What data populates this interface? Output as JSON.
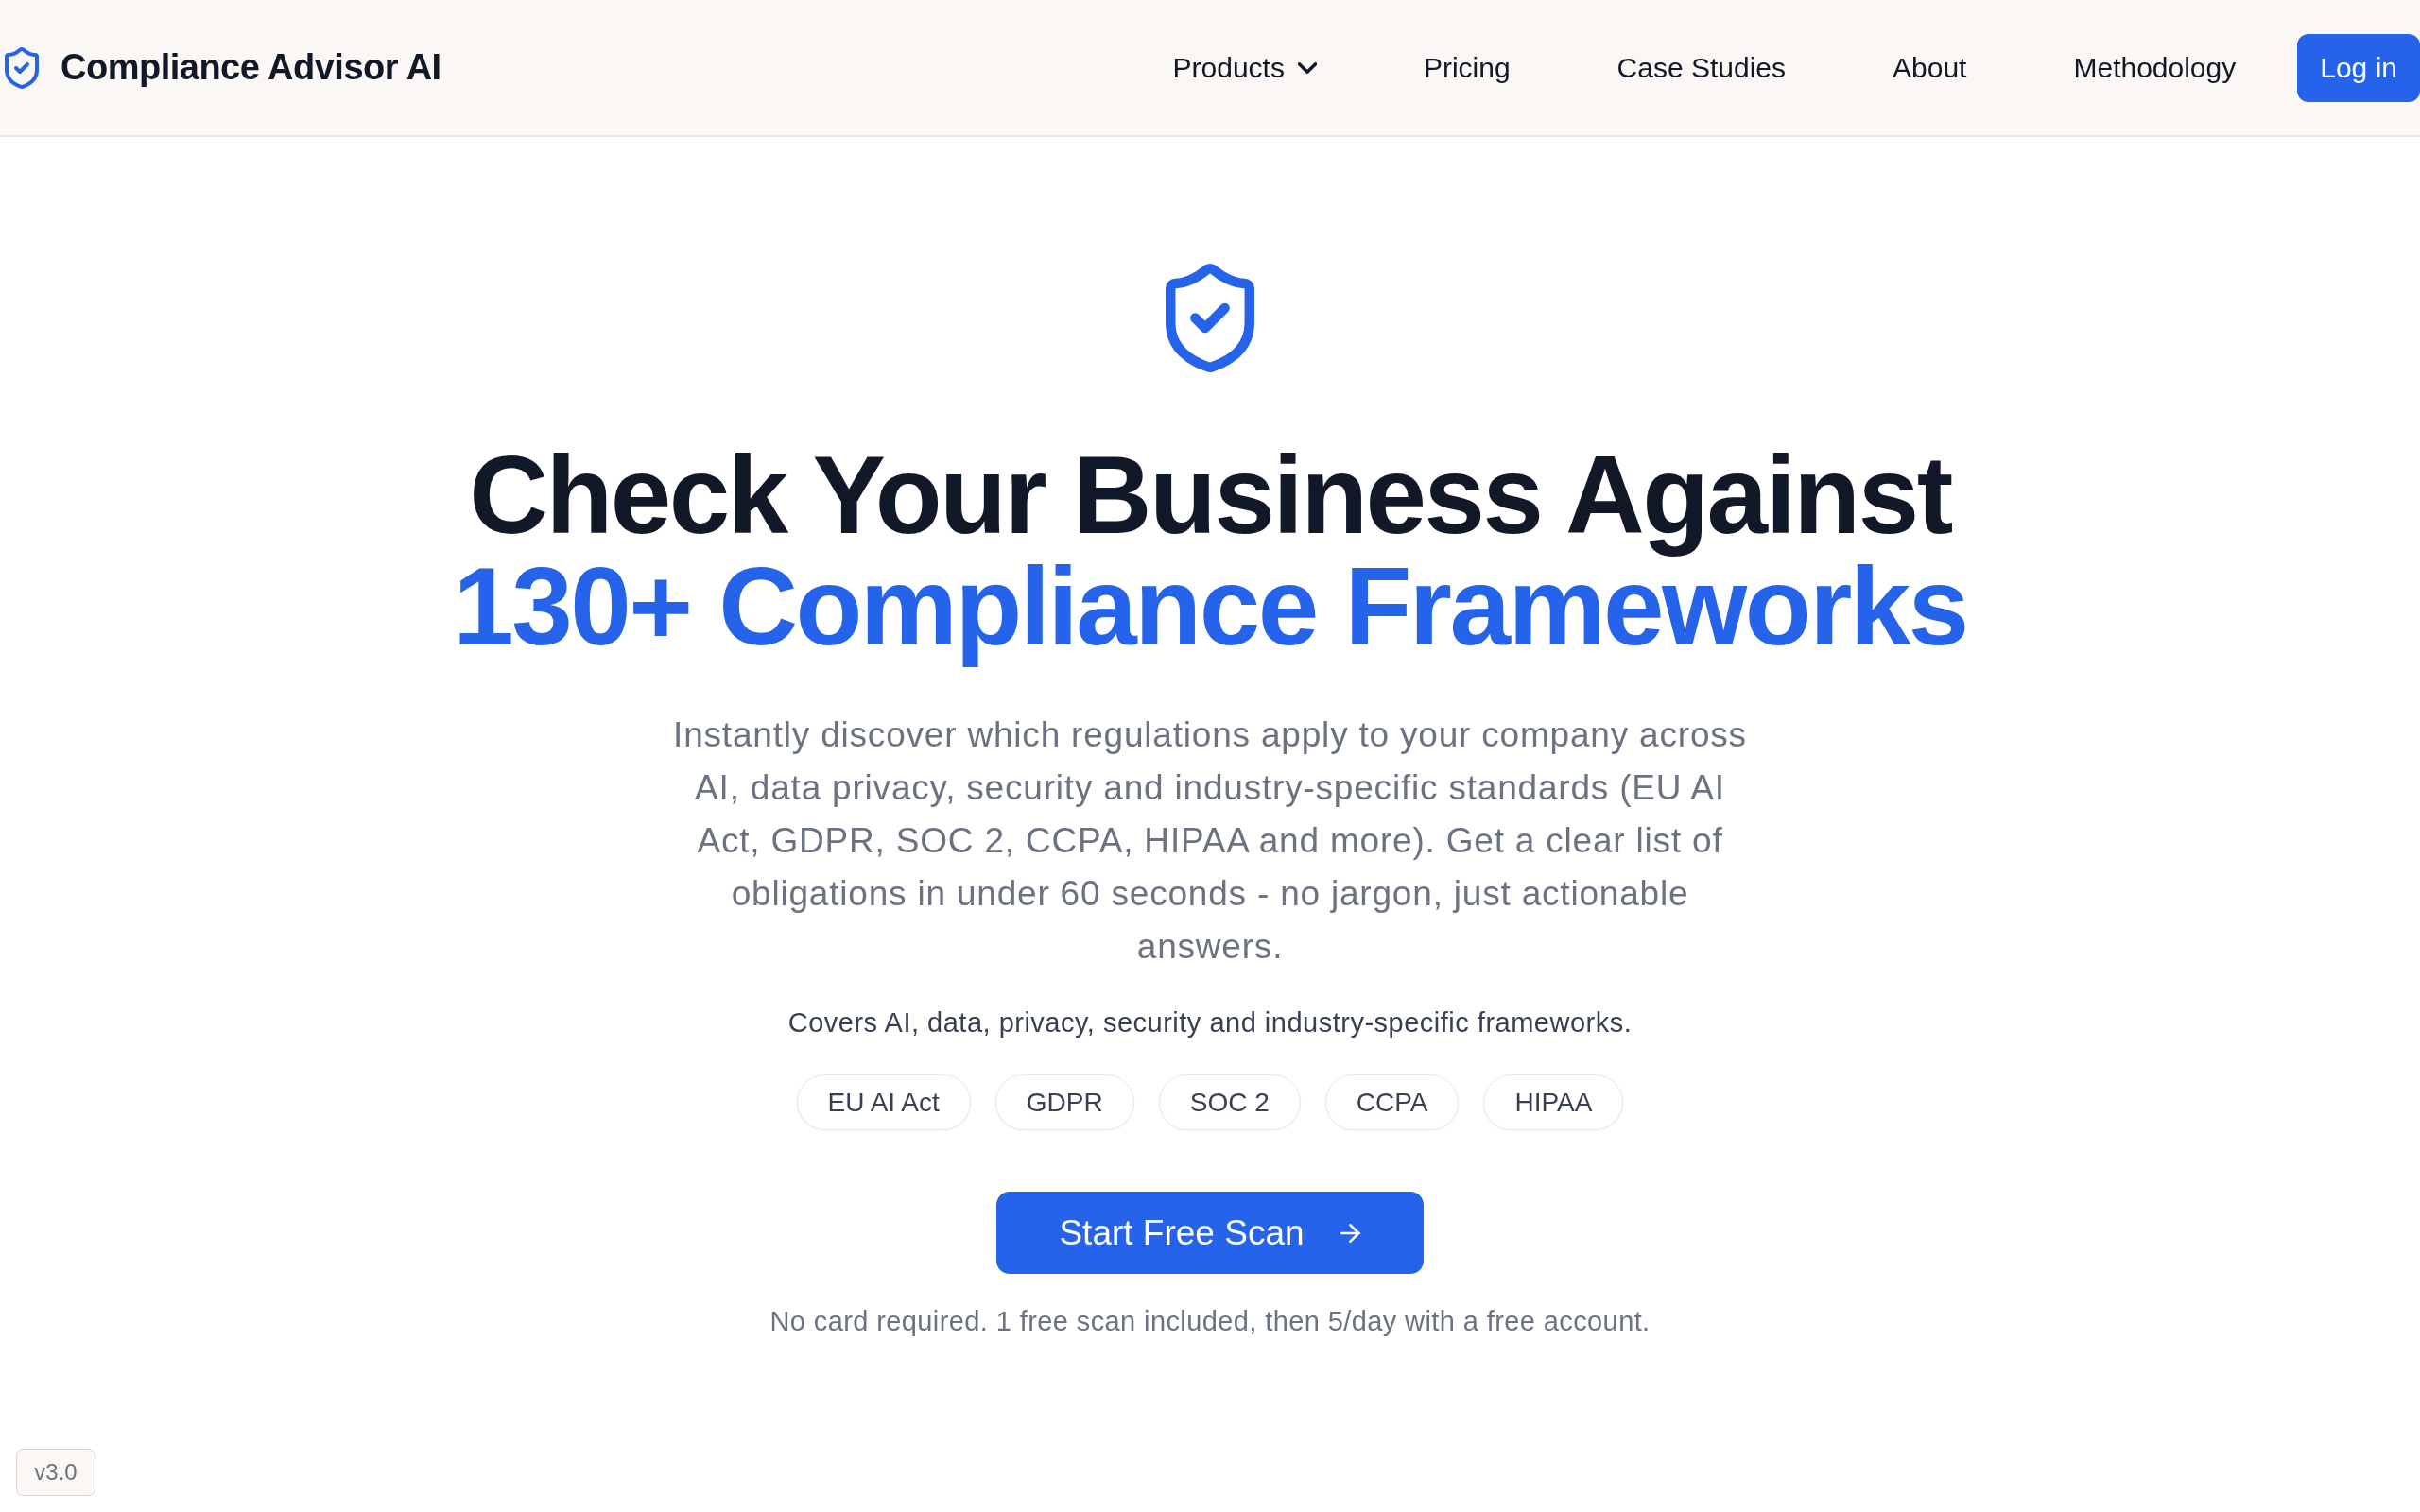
{
  "navbar": {
    "brand": "Compliance Advisor AI",
    "items": [
      {
        "label": "Products",
        "kind": "dropdown"
      },
      {
        "label": "Pricing",
        "kind": "link"
      },
      {
        "label": "Case Studies",
        "kind": "link"
      },
      {
        "label": "About",
        "kind": "link"
      },
      {
        "label": "Methodology",
        "kind": "link"
      }
    ],
    "login_button": "Log in"
  },
  "hero": {
    "title": "Check Your Business Against",
    "title_highlight": "130+ Compliance Frameworks",
    "description": "Instantly discover which regulations apply to your company across AI, data privacy, security and industry-specific standards (EU AI Act, GDPR, SOC 2, CCPA, HIPAA and more). Get a clear list of obligations in under 60 seconds - no jargon, just actionable answers.",
    "coverage_note": "Covers AI, data, privacy, security and industry-specific frameworks.",
    "frameworks": [
      "EU AI Act",
      "GDPR",
      "SOC 2",
      "CCPA",
      "HIPAA"
    ],
    "cta_button": "Start Free Scan",
    "cta_note": "No card required. 1 free scan included, then 5/day with a free account."
  },
  "version_badge": "v3.0"
}
